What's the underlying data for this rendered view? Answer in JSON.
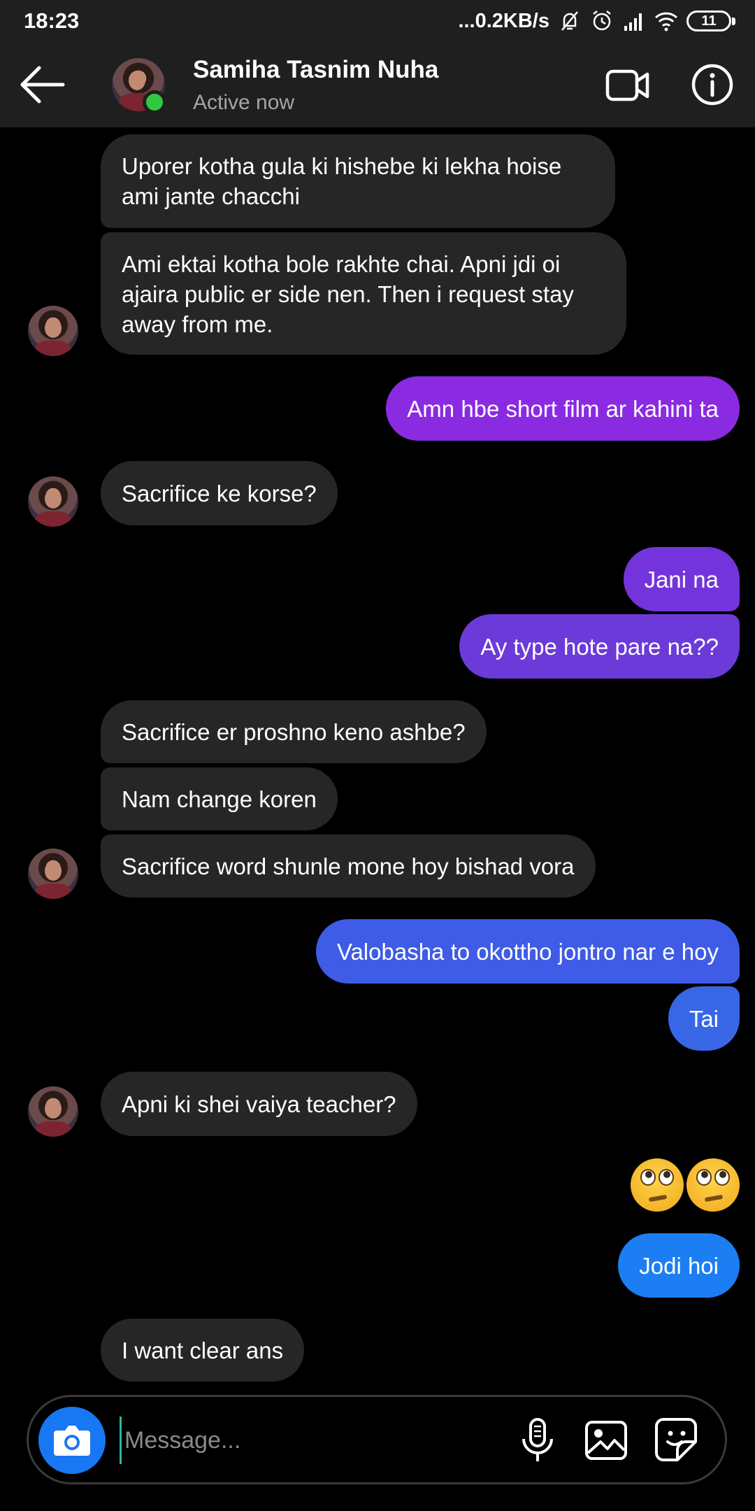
{
  "status_bar": {
    "time": "18:23",
    "network_speed": "...0.2KB/s",
    "battery": "11",
    "icons": [
      "mute-icon",
      "alarm-icon",
      "signal-icon",
      "wifi-icon",
      "battery-icon"
    ]
  },
  "header": {
    "name": "Samiha Tasnim Nuha",
    "status": "Active now",
    "icons": [
      "back-arrow-icon",
      "video-call-icon",
      "info-icon"
    ]
  },
  "messages": {
    "m1": "Uporer kotha gula ki hishebe ki lekha hoise ami jante chacchi",
    "m2": "Ami ektai kotha bole rakhte chai. Apni jdi oi ajaira public er side nen. Then i request stay away from me.",
    "m3": "Amn hbe short film ar kahini ta",
    "m4": "Sacrifice ke korse?",
    "m5": "Jani na",
    "m6": "Ay type hote pare na??",
    "m7": "Sacrifice er proshno keno ashbe?",
    "m8": "Nam change koren",
    "m9": "Sacrifice word shunle mone hoy bishad vora",
    "m10": "Valobasha to okottho jontro nar e hoy",
    "m11": "Tai",
    "m12": "Apni ki shei vaiya teacher?",
    "m13_emoji": "face-with-rolling-eyes x2",
    "m14": "Jodi hoi",
    "m15": "I want clear ans"
  },
  "colors": {
    "incoming_bubble": "#262626",
    "outgoing_purple": "#8a2be2",
    "outgoing_violet": "#6c3ad8",
    "outgoing_blue": "#3a66e4",
    "outgoing_light_blue": "#1c7ef2",
    "accent": "#1877f2",
    "online": "#31c93f"
  },
  "composer": {
    "placeholder": "Message...",
    "icons": [
      "camera-icon",
      "microphone-icon",
      "image-icon",
      "sticker-icon"
    ]
  }
}
